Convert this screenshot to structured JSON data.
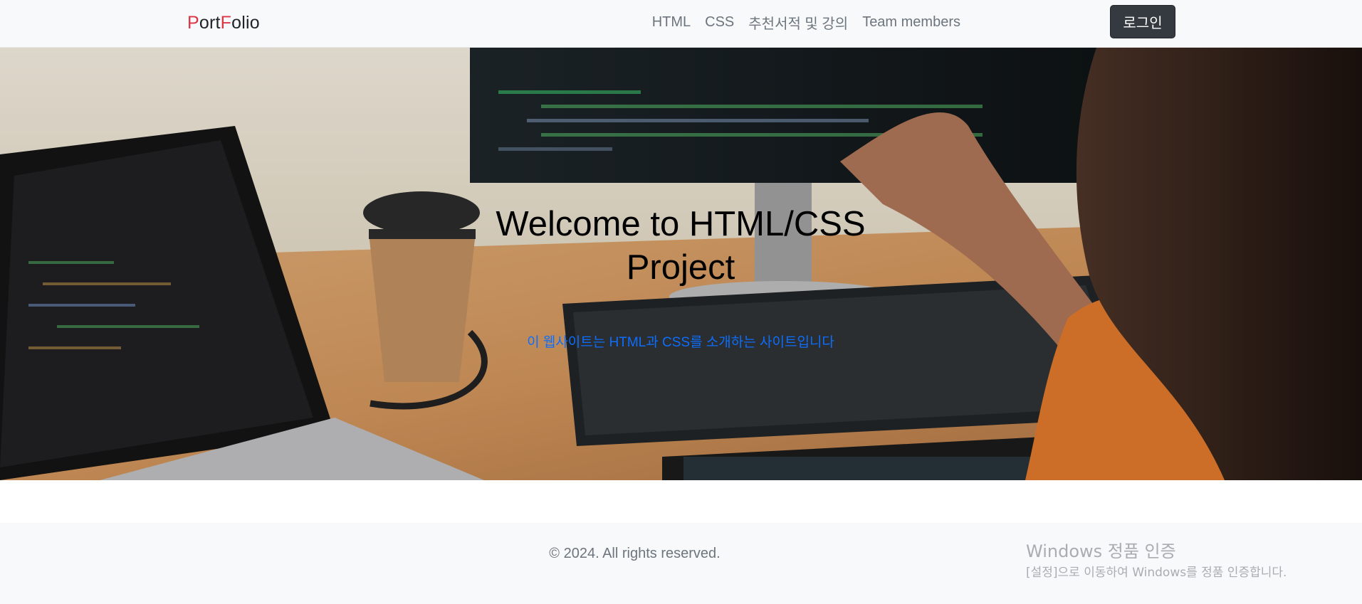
{
  "navbar": {
    "brand_p": "P",
    "brand_ort": "ort",
    "brand_f": "F",
    "brand_olio": "olio",
    "links": [
      "HTML",
      "CSS",
      "추천서적 및 강의",
      "Team members"
    ],
    "login_label": "로그인"
  },
  "hero": {
    "title_line1": "Welcome to HTML/CSS",
    "title_line2": "Project",
    "subtitle": "이 웹사이트는 HTML과 CSS를 소개하는 사이트입니다"
  },
  "footer": {
    "copyright": "© 2024. All rights reserved."
  },
  "watermark": {
    "title": "Windows 정품 인증",
    "subtitle": "[설정]으로 이동하여 Windows를 정품 인증합니다."
  },
  "colors": {
    "brand_accent": "#dc3545",
    "subtitle_blue": "#0d6efd",
    "login_bg": "#343a40"
  }
}
